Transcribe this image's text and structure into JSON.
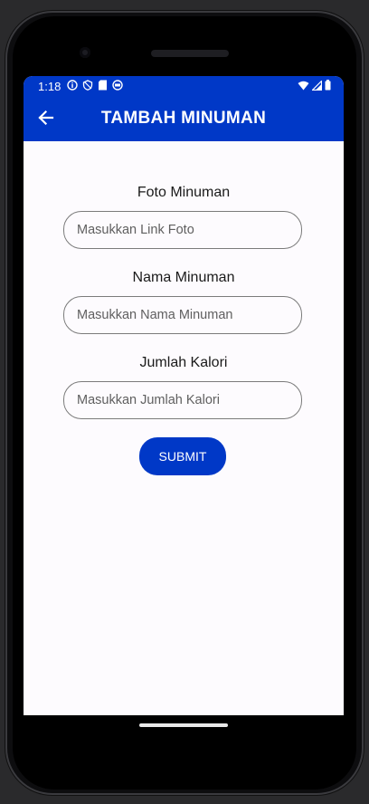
{
  "status_bar": {
    "time": "1:18",
    "left_icons": [
      "info-icon",
      "shield-icon",
      "sd-card-icon",
      "sync-icon"
    ],
    "right_icons": [
      "wifi-icon",
      "signal-icon",
      "battery-icon"
    ]
  },
  "app_bar": {
    "title": "TAMBAH MINUMAN",
    "back_icon": "arrow-left-icon",
    "color": "#0038c7"
  },
  "form": {
    "photo_label": "Foto Minuman",
    "photo_placeholder": "Masukkan Link Foto",
    "name_label": "Nama Minuman",
    "name_placeholder": "Masukkan Nama Minuman",
    "calorie_label": "Jumlah Kalori",
    "calorie_placeholder": "Masukkan Jumlah Kalori",
    "submit_label": "SUBMIT"
  }
}
